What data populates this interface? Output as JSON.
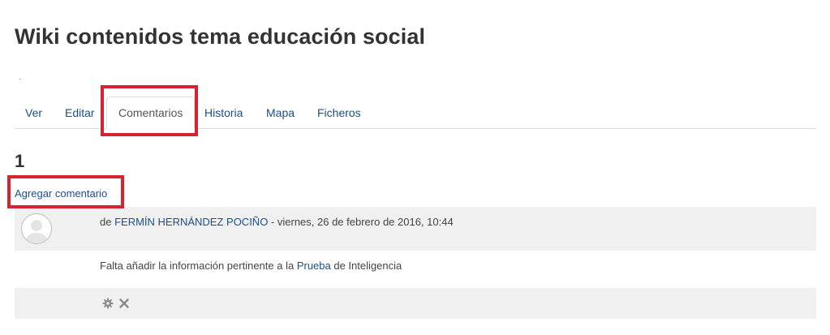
{
  "page": {
    "title": "Wiki contenidos tema educación social"
  },
  "tabs": [
    {
      "label": "Ver",
      "active": false
    },
    {
      "label": "Editar",
      "active": false
    },
    {
      "label": "Comentarios",
      "active": true
    },
    {
      "label": "Historia",
      "active": false
    },
    {
      "label": "Mapa",
      "active": false
    },
    {
      "label": "Ficheros",
      "active": false
    }
  ],
  "comments": {
    "count": "1",
    "add_label": "Agregar comentario",
    "items": [
      {
        "by_prefix": "de ",
        "author": "FERMÍN HERNÁNDEZ POCIÑO",
        "date": " - viernes, 26 de febrero de 2016, 10:44",
        "text_before": "Falta añadir la información pertinente a la ",
        "link": "Prueba",
        "text_after": " de Inteligencia",
        "actions": [
          {
            "icon": "gear-icon"
          },
          {
            "icon": "close-icon"
          }
        ]
      }
    ]
  },
  "colors": {
    "link": "#1a4f8a",
    "highlight": "#d9222f",
    "panel_bg": "#f0f0f0"
  }
}
